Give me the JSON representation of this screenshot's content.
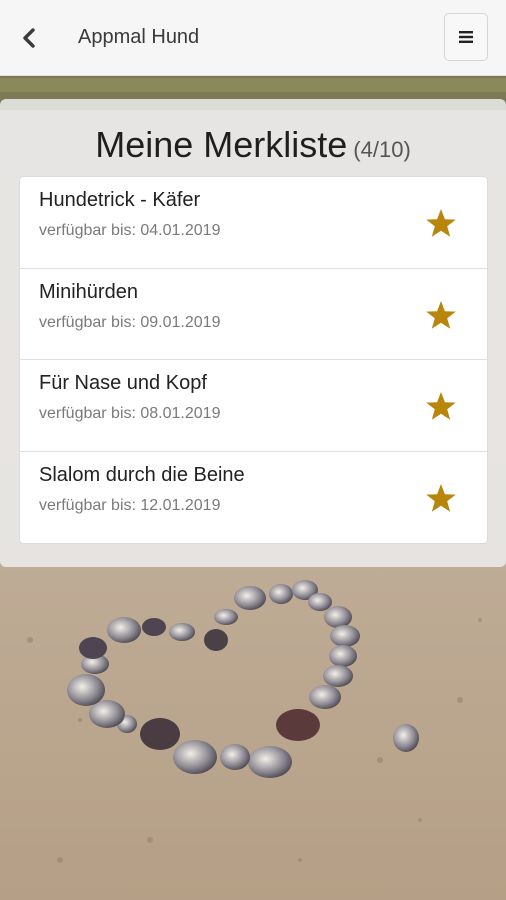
{
  "header": {
    "title": "Appmal Hund",
    "back_icon": "chevron-left-icon",
    "menu_icon": "hamburger-icon"
  },
  "page": {
    "title": "Meine Merkliste",
    "count": "(4/10)"
  },
  "items": [
    {
      "title": "Hundetrick - Käfer",
      "subtitle": "verfügbar bis: 04.01.2019",
      "starred": true
    },
    {
      "title": "Minihürden",
      "subtitle": "verfügbar bis: 09.01.2019",
      "starred": true
    },
    {
      "title": "Für Nase und Kopf",
      "subtitle": "verfügbar bis: 08.01.2019",
      "starred": true
    },
    {
      "title": "Slalom durch die Beine",
      "subtitle": "verfügbar bis: 12.01.2019",
      "starred": true
    }
  ],
  "colors": {
    "star": "#b8860b",
    "panel": "#ececec",
    "topbar": "#f6f6f6"
  }
}
